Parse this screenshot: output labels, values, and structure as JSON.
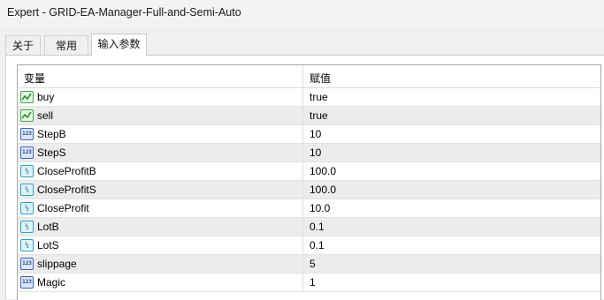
{
  "window": {
    "title": "Expert - GRID-EA-Manager-Full-and-Semi-Auto"
  },
  "tabs": [
    {
      "label": "关于"
    },
    {
      "label": "常用"
    },
    {
      "label": "输入参数"
    }
  ],
  "active_tab": "输入参数",
  "table": {
    "columns": {
      "variable": "变量",
      "value": "赋值"
    },
    "rows": [
      {
        "name": "buy",
        "value": "true",
        "type_icon": "bool-icon"
      },
      {
        "name": "sell",
        "value": "true",
        "type_icon": "bool-icon"
      },
      {
        "name": "StepB",
        "value": "10",
        "type_icon": "integer-icon"
      },
      {
        "name": "StepS",
        "value": "10",
        "type_icon": "integer-icon"
      },
      {
        "name": "CloseProfitB",
        "value": "100.0",
        "type_icon": "double-icon"
      },
      {
        "name": "CloseProfitS",
        "value": "100.0",
        "type_icon": "double-icon"
      },
      {
        "name": "CloseProfit",
        "value": "10.0",
        "type_icon": "double-icon"
      },
      {
        "name": "LotB",
        "value": "0.1",
        "type_icon": "double-icon"
      },
      {
        "name": "LotS",
        "value": "0.1",
        "type_icon": "double-icon"
      },
      {
        "name": "slippage",
        "value": "5",
        "type_icon": "integer-icon"
      },
      {
        "name": "Magic",
        "value": "1",
        "type_icon": "integer-icon"
      }
    ]
  },
  "icon_glyphs": {
    "integer-icon": "123",
    "double-icon": "½"
  },
  "colors": {
    "window_bg": "#f0f0f0",
    "grid_bg": "#ffffff",
    "alt_row_bg": "#ececec",
    "bool_icon": "#3aa84a",
    "int_icon": "#3b63b5",
    "double_icon": "#2fa4c4"
  }
}
